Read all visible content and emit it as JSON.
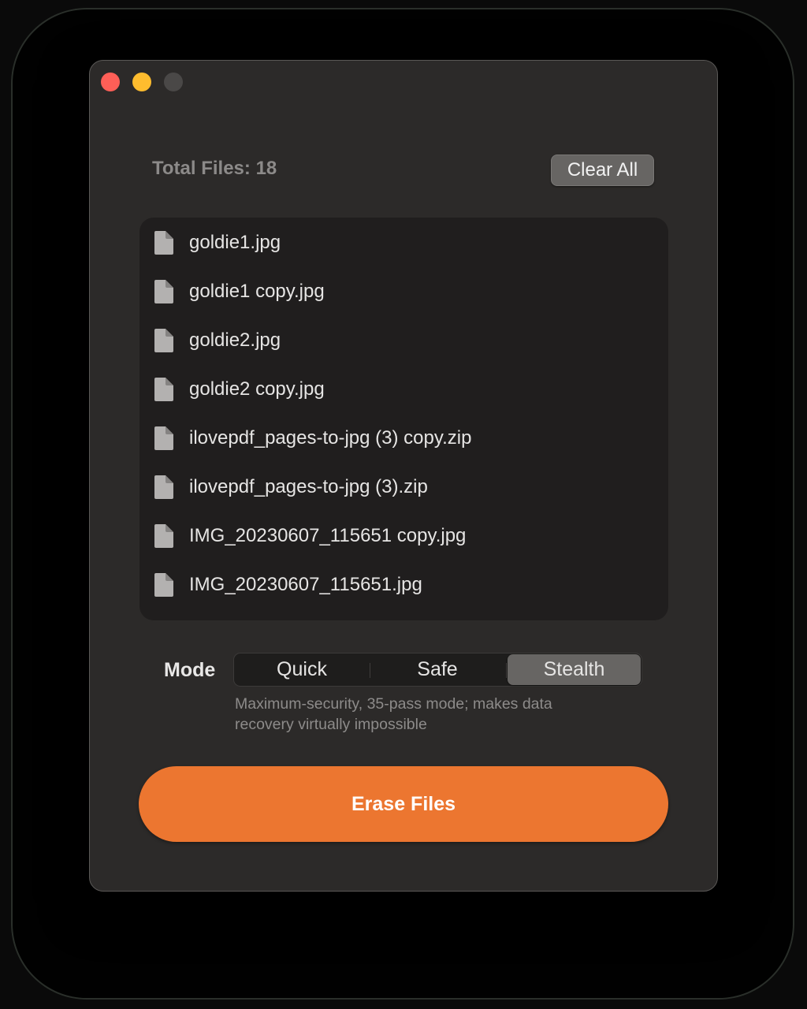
{
  "window": {
    "controls": [
      "close",
      "minimize",
      "zoom"
    ],
    "control_colors": {
      "close": "#ff5f57",
      "minimize": "#febc2e",
      "zoom": "#4a4847"
    }
  },
  "header": {
    "total_files_label": "Total Files: 18",
    "clear_all_label": "Clear All"
  },
  "files": [
    {
      "name": "goldie1.jpg",
      "icon": "document-icon"
    },
    {
      "name": "goldie1 copy.jpg",
      "icon": "document-icon"
    },
    {
      "name": "goldie2.jpg",
      "icon": "document-icon"
    },
    {
      "name": "goldie2 copy.jpg",
      "icon": "document-icon"
    },
    {
      "name": "ilovepdf_pages-to-jpg (3) copy.zip",
      "icon": "document-icon"
    },
    {
      "name": "ilovepdf_pages-to-jpg (3).zip",
      "icon": "document-icon"
    },
    {
      "name": "IMG_20230607_115651 copy.jpg",
      "icon": "document-icon"
    },
    {
      "name": "IMG_20230607_115651.jpg",
      "icon": "document-icon"
    }
  ],
  "mode": {
    "label": "Mode",
    "options": [
      "Quick",
      "Safe",
      "Stealth"
    ],
    "selected": "Stealth",
    "description_lines": [
      "Maximum-security, 35-pass mode; makes data",
      "recovery virtually impossible"
    ]
  },
  "actions": {
    "erase_label": "Erase Files",
    "accent_color": "#ec7630"
  }
}
